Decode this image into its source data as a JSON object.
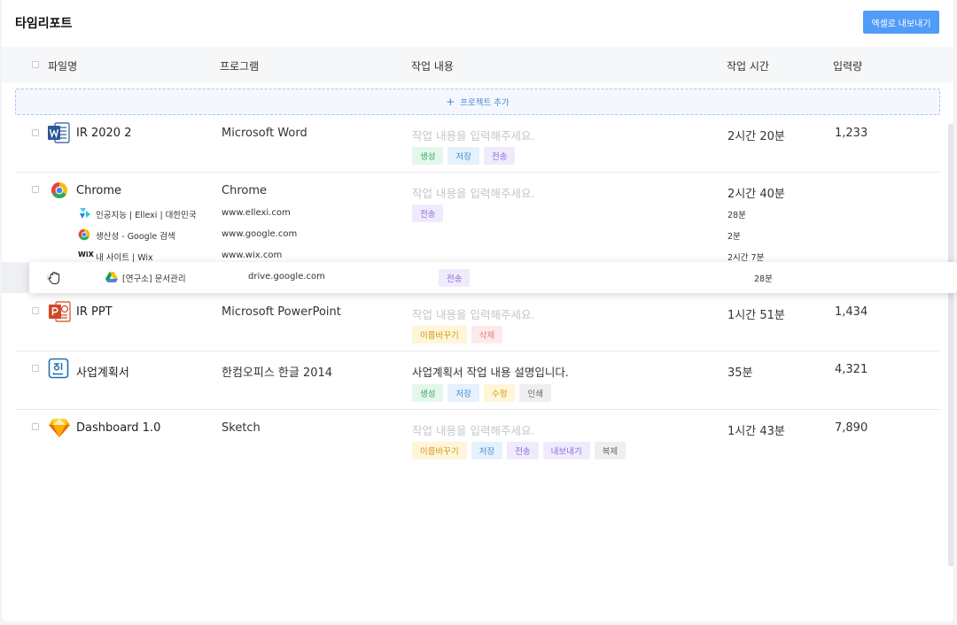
{
  "page": {
    "title": "타임리포트",
    "export_label": "엑셀로 내보내기"
  },
  "columns": {
    "file": "파일명",
    "program": "프로그램",
    "work": "작업 내용",
    "time": "작업 시간",
    "count": "입력량"
  },
  "add_project": {
    "plus": "+",
    "label": "프로젝트 추가"
  },
  "rows": [
    {
      "file": "IR 2020 2",
      "icon": "word-icon",
      "program": "Microsoft Word",
      "work": "작업 내용을 입력해주세요.",
      "time": "2시간 20분",
      "count": "1,233",
      "tags": [
        "생성",
        "저장",
        "전송"
      ]
    },
    {
      "file": "Chrome",
      "icon": "chrome-icon",
      "program": "Chrome",
      "work": "작업 내용을 입력해주세요.",
      "time": "2시간 40분",
      "count": "",
      "tags": [
        "전송"
      ],
      "subs": [
        {
          "name": "인공지능 | Ellexi | 대한민국",
          "icon": "ellexi-icon",
          "url": "www.ellexi.com",
          "time": "28분"
        },
        {
          "name": "생산성 - Google 검색",
          "icon": "google-icon",
          "url": "www.google.com",
          "time": "2분"
        },
        {
          "name": "내 사이트 | Wix",
          "icon": "wix-icon",
          "url": "www.wix.com",
          "time": "2시간 7분"
        }
      ]
    },
    {
      "file": "IR PPT",
      "icon": "powerpoint-icon",
      "program": "Microsoft PowerPoint",
      "work": "작업 내용을 입력해주세요.",
      "time": "1시간 51분",
      "count": "1,434",
      "tags": [
        "이름바꾸기",
        "삭제"
      ]
    },
    {
      "file": "사업계획서",
      "icon": "hangul-icon",
      "program": "한컴오피스 한글 2014",
      "work": "사업계획서 작업 내용 설명입니다.",
      "time": "35분",
      "count": "4,321",
      "tags": [
        "생성",
        "저장",
        "수정",
        "인쇄"
      ]
    },
    {
      "file": "Dashboard 1.0",
      "icon": "sketch-icon",
      "program": "Sketch",
      "work": "작업 내용을 입력해주세요.",
      "time": "1시간 43분",
      "count": "7,890",
      "tags": [
        "이름바꾸기",
        "저장",
        "전송",
        "내보내기",
        "복제"
      ]
    }
  ],
  "dragging": {
    "name": "[연구소] 문서관리",
    "icon": "google-drive-icon",
    "url": "drive.google.com",
    "tag": "전송",
    "time": "28분",
    "wix_mark": "WiX"
  },
  "colors": {
    "accent": "#4f9cf9",
    "drop_zone": "#a9c8f2"
  }
}
